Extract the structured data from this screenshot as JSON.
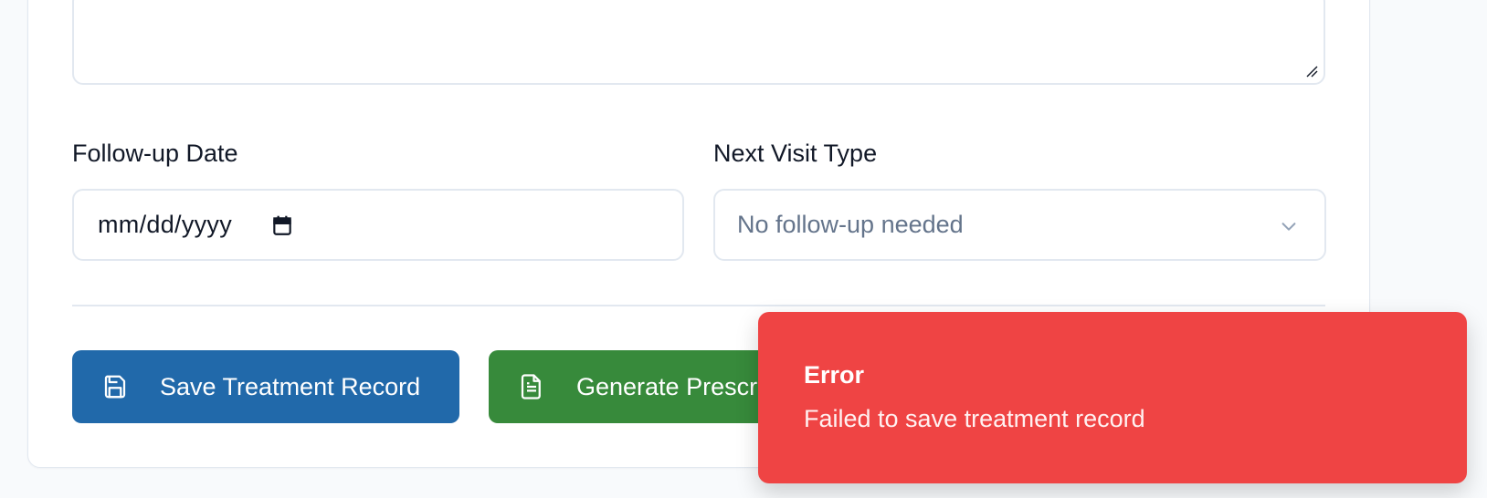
{
  "form": {
    "followup_label": "Follow-up Date",
    "followup_placeholder": "mm/dd/yyyy",
    "visit_type_label": "Next Visit Type",
    "visit_type_value": "No follow-up needed"
  },
  "actions": {
    "save_label": "Save Treatment Record",
    "generate_label": "Generate Prescription"
  },
  "toast": {
    "title": "Error",
    "message": "Failed to save treatment record"
  },
  "colors": {
    "save_button": "#2169aa",
    "generate_button": "#378a3b",
    "toast_error": "#ef4444",
    "field_border": "#e2e8f0"
  },
  "icons": {
    "save": "save-icon",
    "generate": "document-icon",
    "calendar": "calendar-icon",
    "chevron": "chevron-down-icon"
  }
}
